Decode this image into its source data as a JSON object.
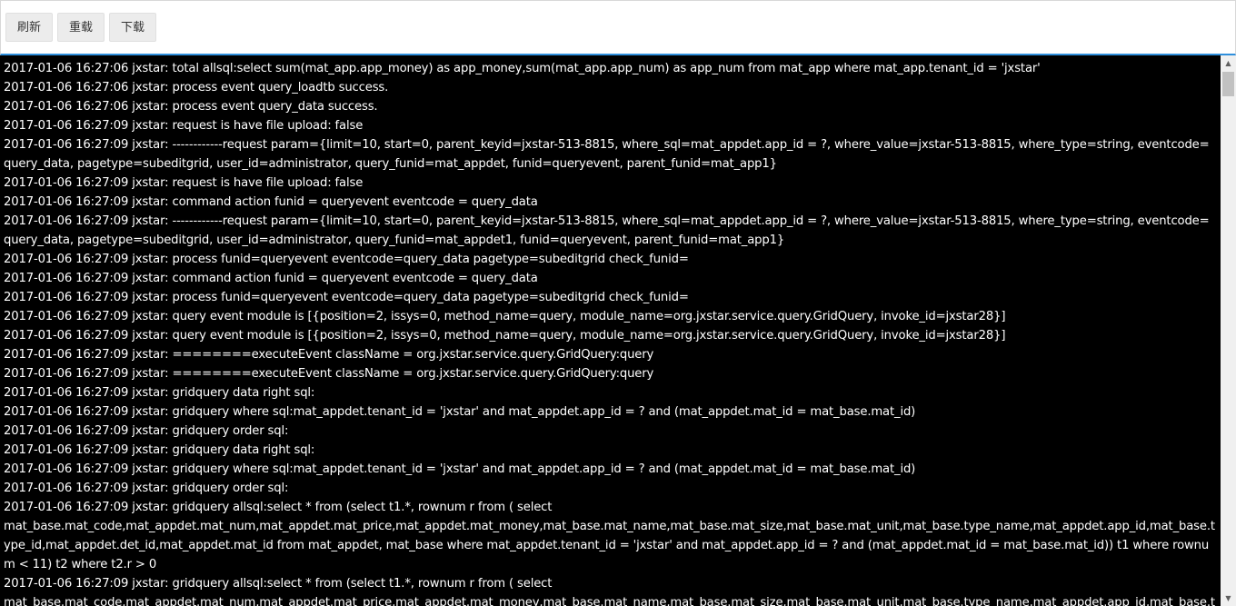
{
  "toolbar": {
    "refresh_label": "刷新",
    "reload_label": "重载",
    "download_label": "下载"
  },
  "scrollbar": {
    "up_icon": "▲",
    "down_icon": "▼"
  },
  "log_lines": [
    "2017-01-06 16:27:06 jxstar: total allsql:select sum(mat_app.app_money) as app_money,sum(mat_app.app_num) as app_num from mat_app where mat_app.tenant_id = 'jxstar'",
    "2017-01-06 16:27:06 jxstar: process event query_loadtb success.",
    "2017-01-06 16:27:06 jxstar: process event query_data success.",
    "2017-01-06 16:27:09 jxstar: request is have file upload: false",
    "2017-01-06 16:27:09 jxstar: ------------request param={limit=10, start=0, parent_keyid=jxstar-513-8815, where_sql=mat_appdet.app_id = ?, where_value=jxstar-513-8815, where_type=string, eventcode=query_data, pagetype=subeditgrid, user_id=administrator, query_funid=mat_appdet, funid=queryevent, parent_funid=mat_app1}",
    "2017-01-06 16:27:09 jxstar: request is have file upload: false",
    "2017-01-06 16:27:09 jxstar: command action funid = queryevent eventcode = query_data",
    "2017-01-06 16:27:09 jxstar: ------------request param={limit=10, start=0, parent_keyid=jxstar-513-8815, where_sql=mat_appdet.app_id = ?, where_value=jxstar-513-8815, where_type=string, eventcode=query_data, pagetype=subeditgrid, user_id=administrator, query_funid=mat_appdet1, funid=queryevent, parent_funid=mat_app1}",
    "2017-01-06 16:27:09 jxstar: process funid=queryevent eventcode=query_data pagetype=subeditgrid check_funid=",
    "2017-01-06 16:27:09 jxstar: command action funid = queryevent eventcode = query_data",
    "2017-01-06 16:27:09 jxstar: process funid=queryevent eventcode=query_data pagetype=subeditgrid check_funid=",
    "2017-01-06 16:27:09 jxstar: query event module is [{position=2, issys=0, method_name=query, module_name=org.jxstar.service.query.GridQuery, invoke_id=jxstar28}]",
    "2017-01-06 16:27:09 jxstar: query event module is [{position=2, issys=0, method_name=query, module_name=org.jxstar.service.query.GridQuery, invoke_id=jxstar28}]",
    "2017-01-06 16:27:09 jxstar: ========executeEvent className = org.jxstar.service.query.GridQuery:query",
    "2017-01-06 16:27:09 jxstar: ========executeEvent className = org.jxstar.service.query.GridQuery:query",
    "2017-01-06 16:27:09 jxstar: gridquery data right sql:",
    "2017-01-06 16:27:09 jxstar: gridquery where sql:mat_appdet.tenant_id = 'jxstar' and mat_appdet.app_id = ? and (mat_appdet.mat_id = mat_base.mat_id)",
    "2017-01-06 16:27:09 jxstar: gridquery order sql:",
    "2017-01-06 16:27:09 jxstar: gridquery data right sql:",
    "2017-01-06 16:27:09 jxstar: gridquery where sql:mat_appdet.tenant_id = 'jxstar' and mat_appdet.app_id = ? and (mat_appdet.mat_id = mat_base.mat_id)",
    "2017-01-06 16:27:09 jxstar: gridquery order sql:",
    "2017-01-06 16:27:09 jxstar: gridquery allsql:select * from (select t1.*, rownum r from ( select",
    "mat_base.mat_code,mat_appdet.mat_num,mat_appdet.mat_price,mat_appdet.mat_money,mat_base.mat_name,mat_base.mat_size,mat_base.mat_unit,mat_base.type_name,mat_appdet.app_id,mat_base.type_id,mat_appdet.det_id,mat_appdet.mat_id from mat_appdet, mat_base where mat_appdet.tenant_id = 'jxstar' and mat_appdet.app_id = ? and (mat_appdet.mat_id = mat_base.mat_id)) t1 where rownum < 11) t2 where t2.r > 0",
    "2017-01-06 16:27:09 jxstar: gridquery allsql:select * from (select t1.*, rownum r from ( select",
    "mat_base.mat_code,mat_appdet.mat_num,mat_appdet.mat_price,mat_appdet.mat_money,mat_base.mat_name,mat_base.mat_size,mat_base.mat_unit,mat_base.type_name,mat_appdet.app_id,mat_base.type_id,mat_appdet.det_id,mat_appdet.mat_id from mat_appdet, mat_base"
  ]
}
